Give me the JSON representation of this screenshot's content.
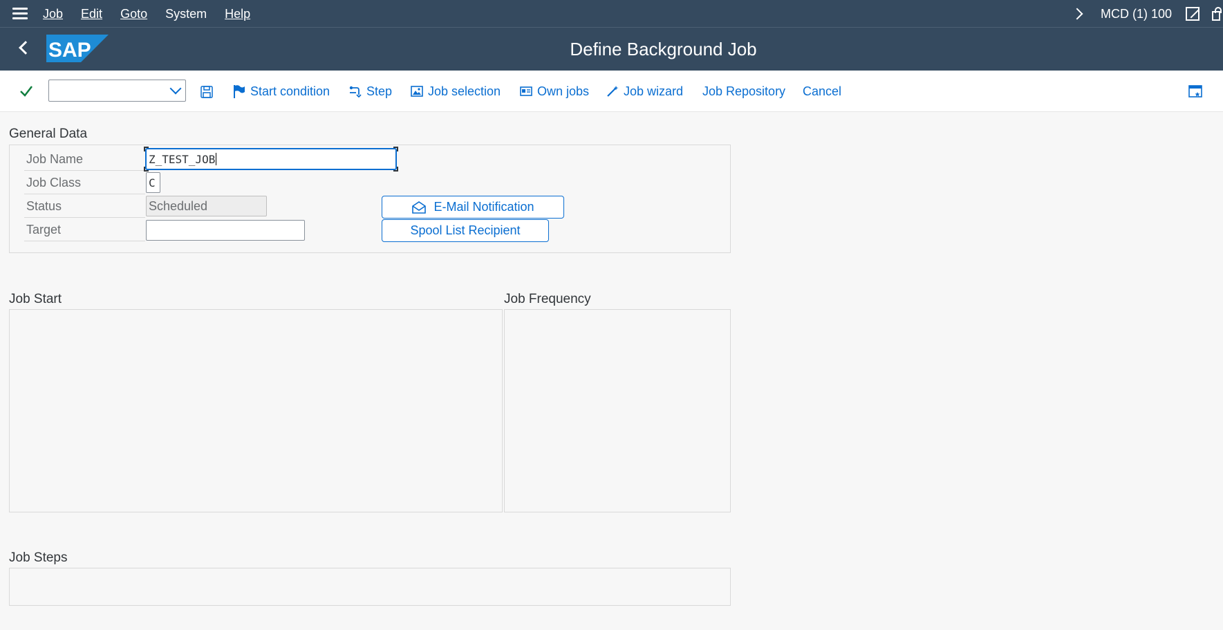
{
  "menu": {
    "items": [
      {
        "label": "Job"
      },
      {
        "label": "Edit"
      },
      {
        "label": "Goto"
      },
      {
        "label": "System"
      },
      {
        "label": "Help"
      }
    ],
    "system_info": "MCD (1) 100"
  },
  "title": "Define Background Job",
  "logo_text": "SAP",
  "toolbar": {
    "command_value": "",
    "buttons": [
      {
        "label": "Start condition",
        "icon": "flag-icon"
      },
      {
        "label": "Step",
        "icon": "step-icon"
      },
      {
        "label": "Job selection",
        "icon": "image-icon"
      },
      {
        "label": "Own jobs",
        "icon": "card-icon"
      },
      {
        "label": "Job wizard",
        "icon": "wand-icon"
      },
      {
        "label": "Job Repository"
      },
      {
        "label": "Cancel"
      }
    ]
  },
  "general_data": {
    "title": "General Data",
    "job_name_label": "Job Name",
    "job_name_value": "Z_TEST_JOB",
    "job_class_label": "Job Class",
    "job_class_value": "C",
    "status_label": "Status",
    "status_value": "Scheduled",
    "target_label": "Target",
    "target_value": "",
    "email_button": "E-Mail Notification",
    "spool_button": "Spool List Recipient"
  },
  "job_start_title": "Job Start",
  "job_frequency_title": "Job Frequency",
  "job_steps_title": "Job Steps",
  "colors": {
    "shell": "#354a5f",
    "accent": "#0a6ed1",
    "check": "#107e3e"
  }
}
